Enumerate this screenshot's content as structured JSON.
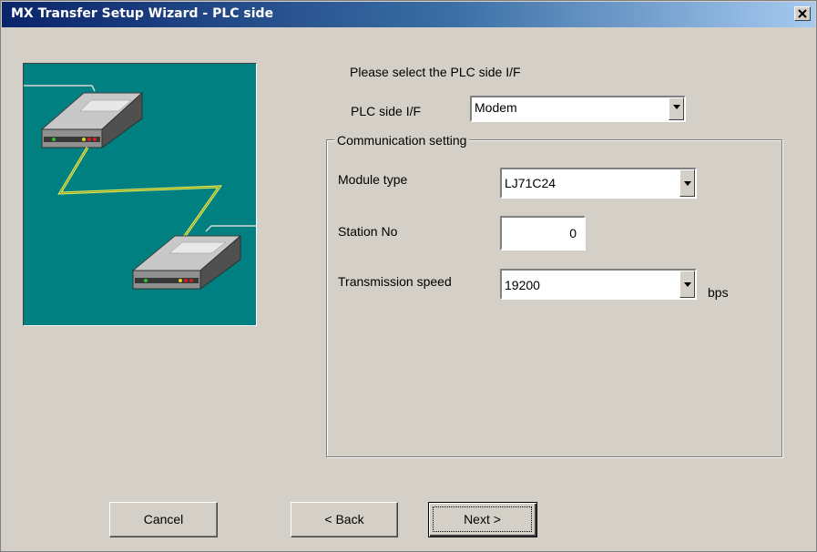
{
  "window": {
    "title": "MX Transfer Setup Wizard - PLC side"
  },
  "prompt": "Please select the PLC side I/F",
  "plc_if": {
    "label": "PLC side I/F",
    "value": "Modem"
  },
  "communication": {
    "title": "Communication setting",
    "module_type": {
      "label": "Module type",
      "value": "LJ71C24"
    },
    "station_no": {
      "label": "Station No",
      "value": "0"
    },
    "transmission_speed": {
      "label": "Transmission speed",
      "value": "19200",
      "unit": "bps"
    }
  },
  "buttons": {
    "cancel": "Cancel",
    "back": "< Back",
    "next": "Next >"
  },
  "colors": {
    "illustration_bg": "#008080",
    "titlebar_start": "#0a246a",
    "titlebar_end": "#a6caf0",
    "cable": "#e8f060"
  },
  "icons": {
    "close": "close-icon",
    "dropdown": "chevron-down-icon",
    "modem": "modem-icon"
  }
}
